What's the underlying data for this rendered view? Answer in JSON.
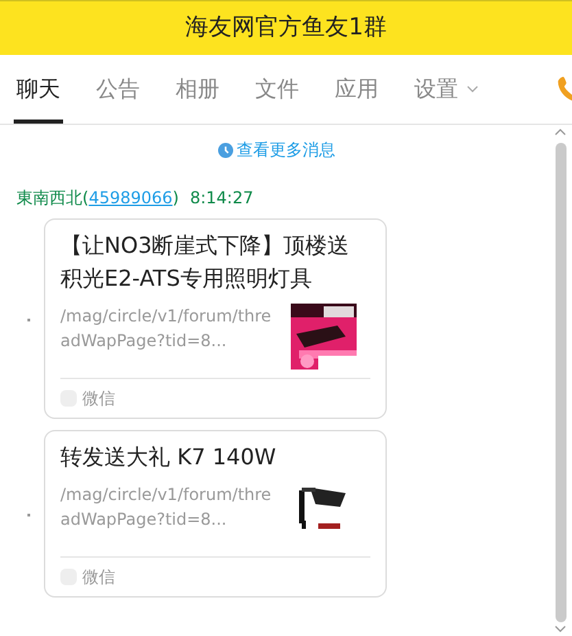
{
  "window": {
    "title": "海友网官方鱼友1群"
  },
  "tabs": [
    {
      "label": "聊天",
      "selected": true,
      "kind": "plain"
    },
    {
      "label": "公告",
      "selected": false,
      "kind": "plain"
    },
    {
      "label": "相册",
      "selected": false,
      "kind": "plain"
    },
    {
      "label": "文件",
      "selected": false,
      "kind": "plain"
    },
    {
      "label": "应用",
      "selected": false,
      "kind": "plain"
    },
    {
      "label": "设置",
      "selected": false,
      "kind": "dropdown"
    }
  ],
  "more_messages": {
    "label": "查看更多消息"
  },
  "message": {
    "sender": "東南西北",
    "sender_id_open": "(",
    "sender_id": "45989066",
    "sender_id_close": ")",
    "time": "8:14:27",
    "cards": [
      {
        "title": "【让NO3断崖式下降】顶楼送积光E2-ATS专用照明灯具",
        "url": "/mag/circle/v1/forum/threadWapPage?tid=8...",
        "source": "微信"
      },
      {
        "title": "转发送大礼 K7 140W",
        "url": "/mag/circle/v1/forum/threadWapPage?tid=8...",
        "source": "微信"
      }
    ]
  }
}
